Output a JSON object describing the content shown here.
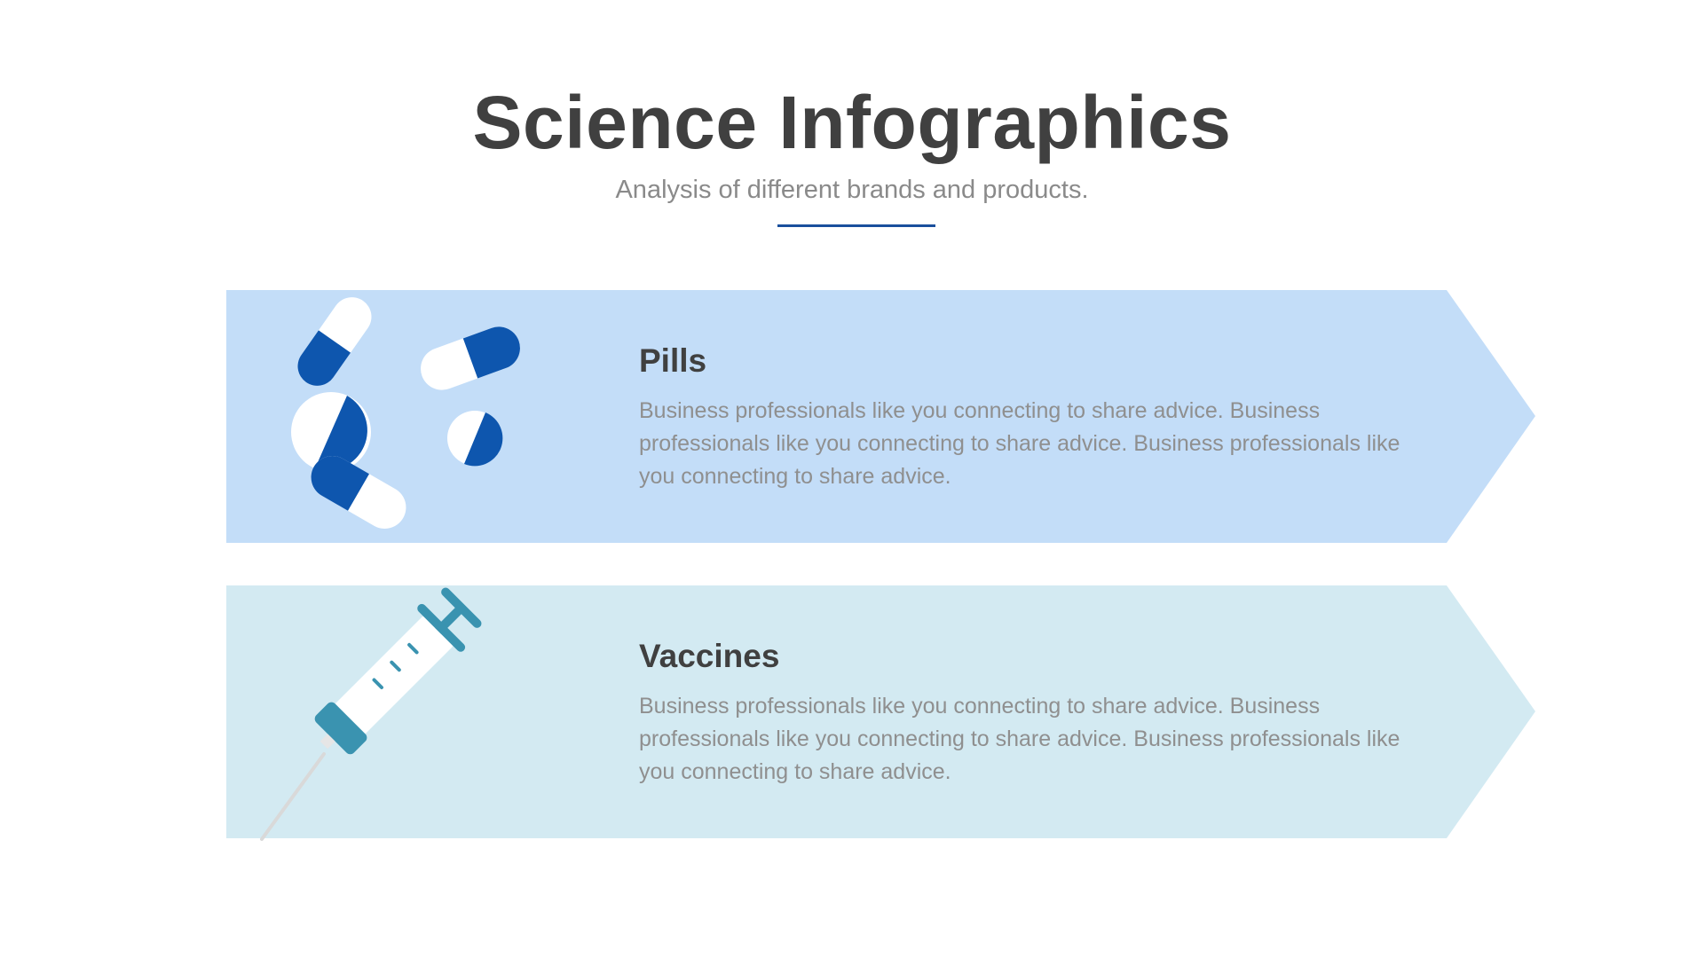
{
  "header": {
    "title": "Science Infographics",
    "subtitle": "Analysis of different brands and products.",
    "accent_color": "#1a4f9c"
  },
  "items": [
    {
      "heading": "Pills",
      "description": "Business professionals like you connecting to share advice. Business professionals like you connecting to share advice. Business professionals like you connecting to share advice.",
      "band_color": "#c3ddf8",
      "icon": "pills-icon",
      "icon_color": "#0e56ae"
    },
    {
      "heading": "Vaccines",
      "description": "Business professionals like you connecting to share advice. Business professionals like you connecting to share advice. Business professionals like you connecting to share advice.",
      "band_color": "#d3eaf2",
      "icon": "syringe-icon",
      "icon_color": "#3a93b0"
    }
  ]
}
